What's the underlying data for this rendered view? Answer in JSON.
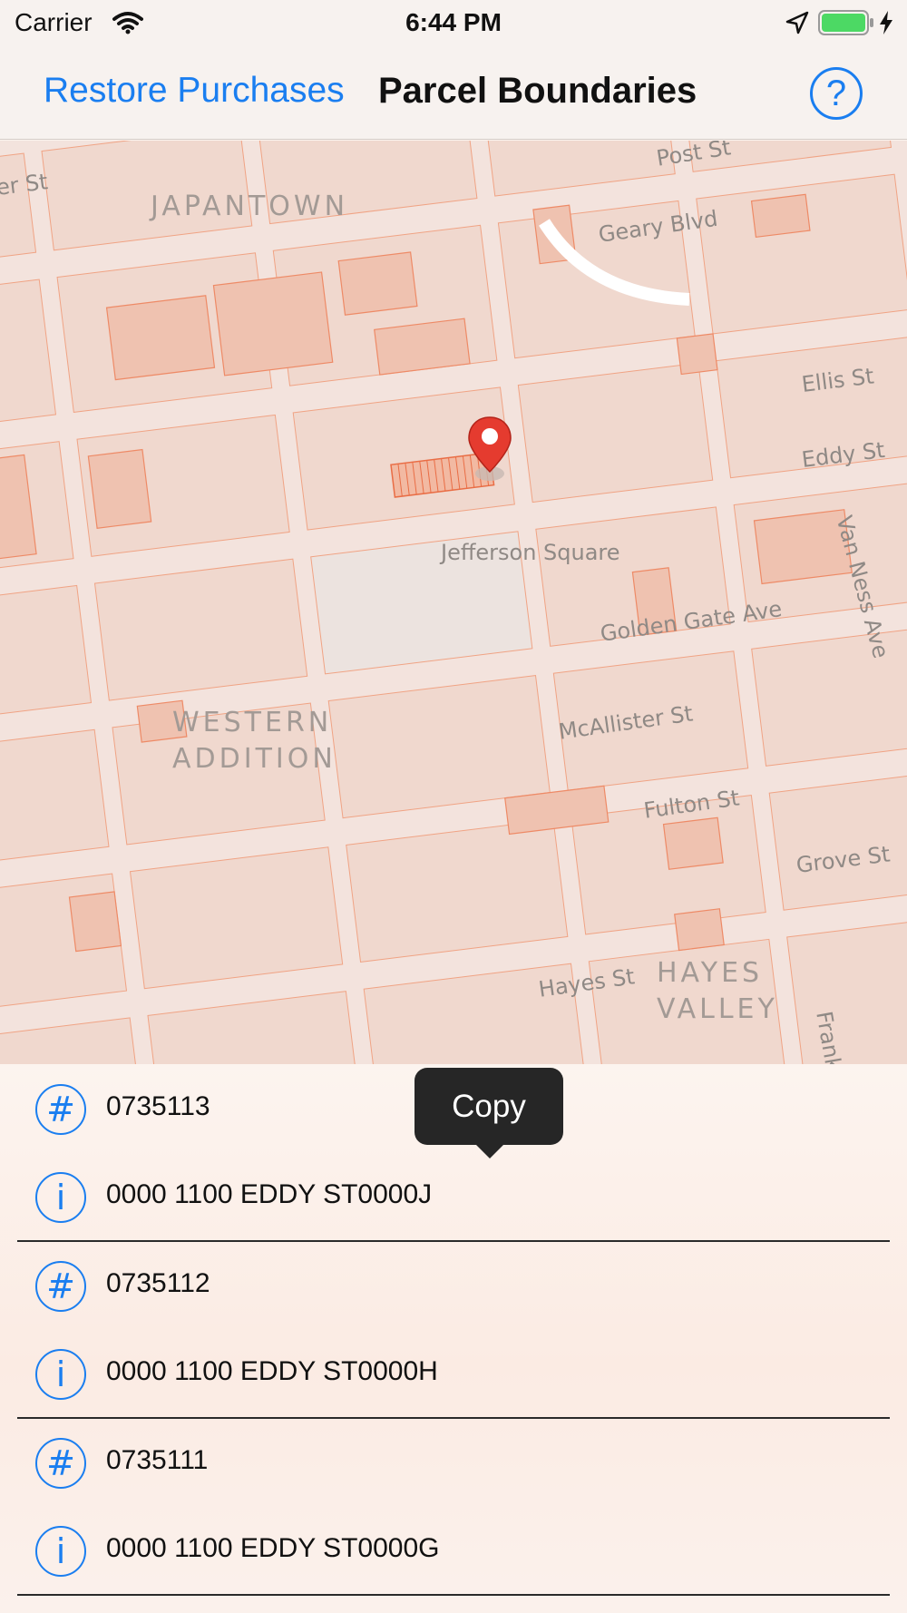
{
  "status_bar": {
    "carrier": "Carrier",
    "time": "6:44 PM"
  },
  "nav": {
    "restore_label": "Restore Purchases",
    "title": "Parcel Boundaries",
    "help_label": "?"
  },
  "map": {
    "districts": [
      "JAPANTOWN",
      "WESTERN\nADDITION",
      "HAYES\nVALLEY"
    ],
    "landmarks": [
      "Jefferson Square"
    ],
    "streets": [
      "er St",
      "Post St",
      "Geary Blvd",
      "Ellis St",
      "Eddy St",
      "Van Ness Ave",
      "Golden Gate Ave",
      "McAllister St",
      "Fulton St",
      "Grove St",
      "Hayes St",
      "Frank"
    ]
  },
  "parcels": [
    {
      "icon": "#",
      "value": "0735113"
    },
    {
      "icon": "i",
      "value": "0000 1100 EDDY ST0000J"
    },
    {
      "icon": "#",
      "value": "0735112"
    },
    {
      "icon": "i",
      "value": "0000 1100 EDDY ST0000H"
    },
    {
      "icon": "#",
      "value": "0735111"
    },
    {
      "icon": "i",
      "value": "0000 1100 EDDY ST0000G"
    }
  ],
  "tooltip": {
    "label": "Copy"
  },
  "colors": {
    "accent": "#1a7ef0",
    "parcel_fill": "#f2c7b5",
    "parcel_stroke": "#f08b67",
    "pin": "#e53b2f"
  }
}
